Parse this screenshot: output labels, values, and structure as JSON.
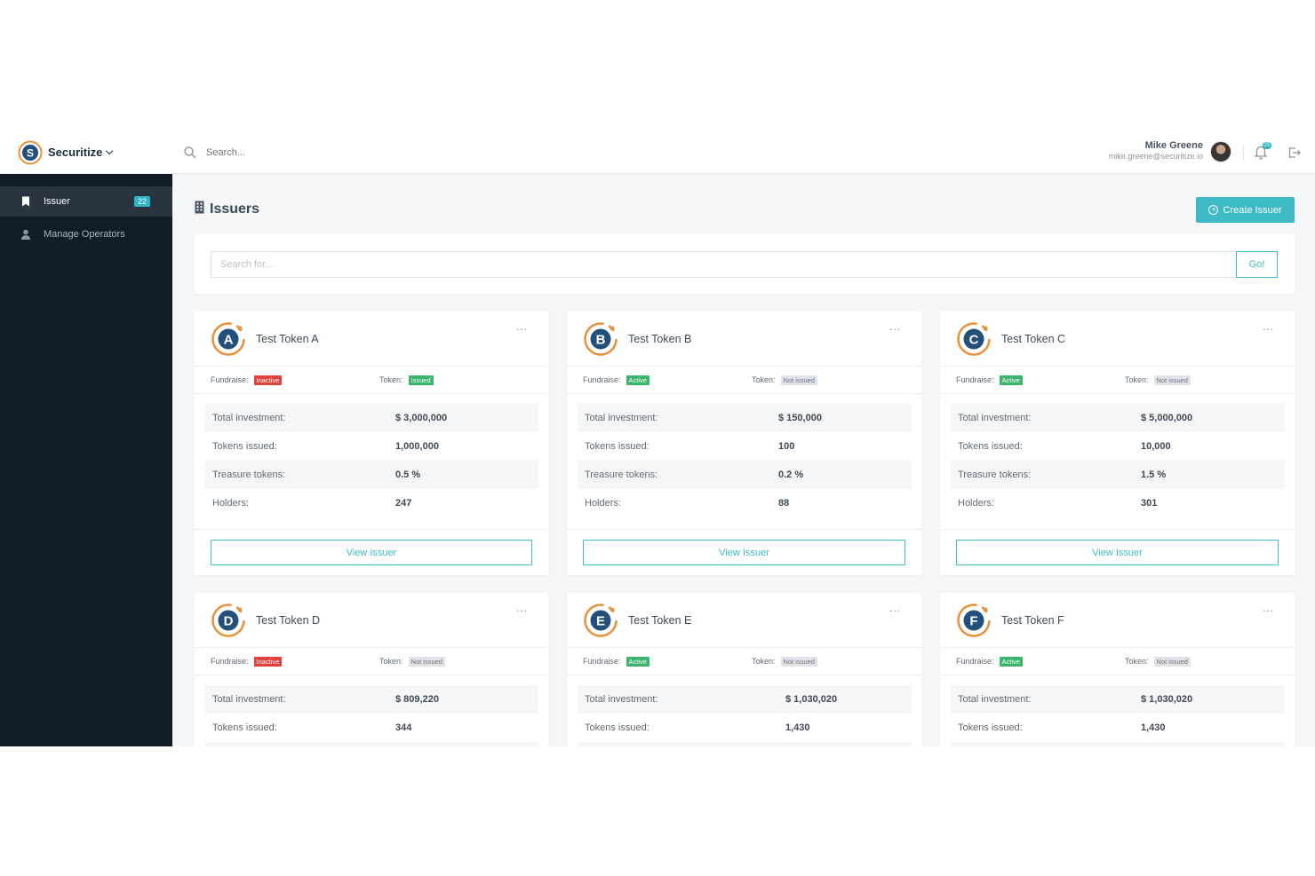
{
  "brand": {
    "name": "Securitize"
  },
  "topbar": {
    "search_placeholder": "Search...",
    "user_name": "Mike Greene",
    "user_email": "mike.greene@securitize.io",
    "notification_count": "25"
  },
  "sidebar": {
    "items": [
      {
        "label": "Issuer",
        "badge": "22",
        "icon": "bookmark-icon",
        "active": true
      },
      {
        "label": "Manage Operators",
        "icon": "user-icon",
        "active": false
      }
    ]
  },
  "page": {
    "title": "Issuers",
    "create_button": "Create Issuer",
    "filter_placeholder": "Search for...",
    "go_button": "Go!"
  },
  "labels": {
    "fundraise": "Fundraise:",
    "token": "Token:",
    "total_investment": "Total investment:",
    "tokens_issued": "Tokens issued:",
    "treasure_tokens": "Treasure tokens:",
    "holders": "Holders:",
    "view_issuer": "View Issuer",
    "more": "..."
  },
  "colors": {
    "accent": "#3dbac5",
    "sidebar": "#121c28",
    "inactive": "#e0413a",
    "active": "#3bb56c",
    "logo_ring": "#e8913a",
    "logo_core": "#23507a"
  },
  "cards": [
    {
      "letter": "A",
      "name": "Test Token A",
      "fundraise": "Inactive",
      "fundraise_state": "inactive",
      "token": "Issued",
      "token_state": "issued",
      "total_investment": "$ 3,000,000",
      "tokens_issued": "1,000,000",
      "treasure_tokens": "0.5 %",
      "holders": "247"
    },
    {
      "letter": "B",
      "name": "Test Token B",
      "fundraise": "Active",
      "fundraise_state": "active",
      "token": "Not issued",
      "token_state": "notissued",
      "total_investment": "$ 150,000",
      "tokens_issued": "100",
      "treasure_tokens": "0.2 %",
      "holders": "88"
    },
    {
      "letter": "C",
      "name": "Test Token C",
      "fundraise": "Active",
      "fundraise_state": "active",
      "token": "Not issued",
      "token_state": "notissued",
      "total_investment": "$ 5,000,000",
      "tokens_issued": "10,000",
      "treasure_tokens": "1.5 %",
      "holders": "301"
    },
    {
      "letter": "D",
      "name": "Test Token D",
      "fundraise": "Inactive",
      "fundraise_state": "inactive",
      "token": "Not issued",
      "token_state": "notissued",
      "total_investment": "$ 809,220",
      "tokens_issued": "344",
      "treasure_tokens": "",
      "holders": ""
    },
    {
      "letter": "E",
      "name": "Test Token E",
      "fundraise": "Active",
      "fundraise_state": "active",
      "token": "Not issued",
      "token_state": "notissued",
      "total_investment": "$ 1,030,020",
      "tokens_issued": "1,430",
      "treasure_tokens": "",
      "holders": ""
    },
    {
      "letter": "F",
      "name": "Test Token F",
      "fundraise": "Active",
      "fundraise_state": "active",
      "token": "Not issued",
      "token_state": "notissued",
      "total_investment": "$ 1,030,020",
      "tokens_issued": "1,430",
      "treasure_tokens": "",
      "holders": ""
    }
  ]
}
